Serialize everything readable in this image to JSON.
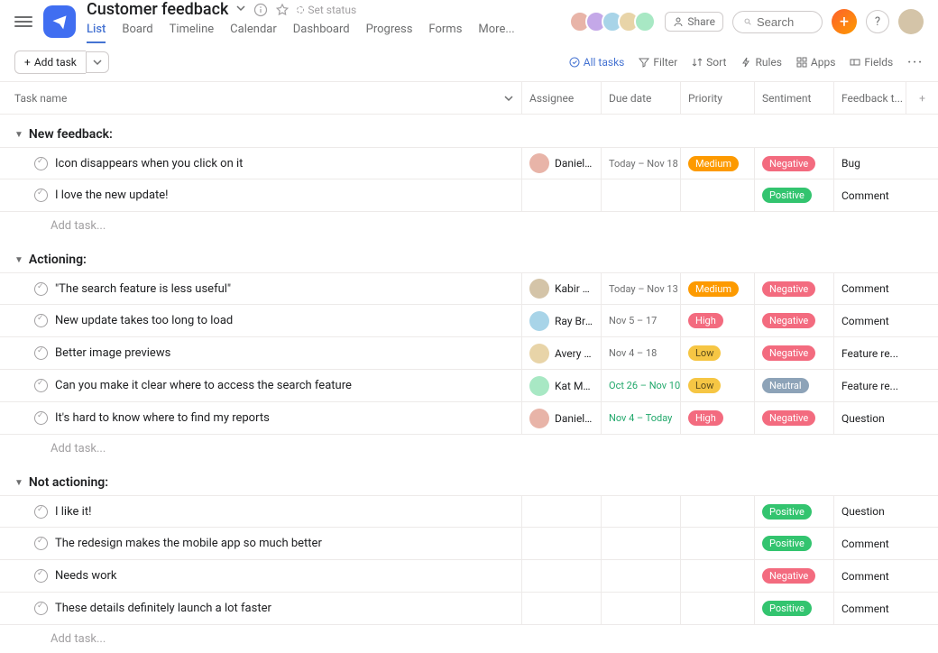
{
  "header": {
    "title": "Customer feedback",
    "set_status": "Set status",
    "share": "Share",
    "search_placeholder": "Search"
  },
  "tabs": [
    "List",
    "Board",
    "Timeline",
    "Calendar",
    "Dashboard",
    "Progress",
    "Forms",
    "More..."
  ],
  "active_tab": 0,
  "toolbar": {
    "add_task": "Add task",
    "all_tasks": "All tasks",
    "filter": "Filter",
    "sort": "Sort",
    "rules": "Rules",
    "apps": "Apps",
    "fields": "Fields"
  },
  "columns": {
    "task": "Task name",
    "assignee": "Assignee",
    "due": "Due date",
    "priority": "Priority",
    "sentiment": "Sentiment",
    "type": "Feedback t..."
  },
  "sections": [
    {
      "name": "New feedback:",
      "tasks": [
        {
          "name": "Icon disappears when you click on it",
          "assignee": "Daniela Var...",
          "av": "av-c1",
          "due": "Today – Nov 18",
          "due_color": "",
          "priority": "Medium",
          "sentiment": "Negative",
          "type": "Bug"
        },
        {
          "name": "I love the new update!",
          "assignee": "",
          "av": "",
          "due": "",
          "due_color": "",
          "priority": "",
          "sentiment": "Positive",
          "type": "Comment"
        }
      ],
      "add": "Add task..."
    },
    {
      "name": "Actioning:",
      "tasks": [
        {
          "name": "\"The search feature is less useful\"",
          "assignee": "Kabir Madan",
          "av": "av-c6",
          "due": "Today – Nov 13",
          "due_color": "",
          "priority": "Medium",
          "sentiment": "Negative",
          "type": "Comment"
        },
        {
          "name": "New update takes too long to load",
          "assignee": "Ray Brooks",
          "av": "av-c3",
          "due": "Nov 5 – 17",
          "due_color": "",
          "priority": "High",
          "sentiment": "Negative",
          "type": "Comment"
        },
        {
          "name": "Better image previews",
          "assignee": "Avery Lomax",
          "av": "av-c4",
          "due": "Nov 4 – 18",
          "due_color": "",
          "priority": "Low",
          "sentiment": "Negative",
          "type": "Feature re..."
        },
        {
          "name": "Can you make it clear where to access the search feature",
          "assignee": "Kat Mooney",
          "av": "av-c5",
          "due": "Oct 26 – Nov 10",
          "due_color": "green",
          "priority": "Low",
          "sentiment": "Neutral",
          "type": "Feature re..."
        },
        {
          "name": "It's hard to know where to find my reports",
          "assignee": "Daniela Var...",
          "av": "av-c1",
          "due": "Nov 4 – Today",
          "due_color": "green",
          "priority": "High",
          "sentiment": "Negative",
          "type": "Question"
        }
      ],
      "add": "Add task..."
    },
    {
      "name": "Not actioning:",
      "tasks": [
        {
          "name": "I like it!",
          "assignee": "",
          "av": "",
          "due": "",
          "due_color": "",
          "priority": "",
          "sentiment": "Positive",
          "type": "Question"
        },
        {
          "name": "The redesign makes the mobile app so much better",
          "assignee": "",
          "av": "",
          "due": "",
          "due_color": "",
          "priority": "",
          "sentiment": "Positive",
          "type": "Comment"
        },
        {
          "name": "Needs work",
          "assignee": "",
          "av": "",
          "due": "",
          "due_color": "",
          "priority": "",
          "sentiment": "Negative",
          "type": "Comment"
        },
        {
          "name": "These details definitely launch a lot faster",
          "assignee": "",
          "av": "",
          "due": "",
          "due_color": "",
          "priority": "",
          "sentiment": "Positive",
          "type": "Comment"
        }
      ],
      "add": "Add task..."
    }
  ]
}
